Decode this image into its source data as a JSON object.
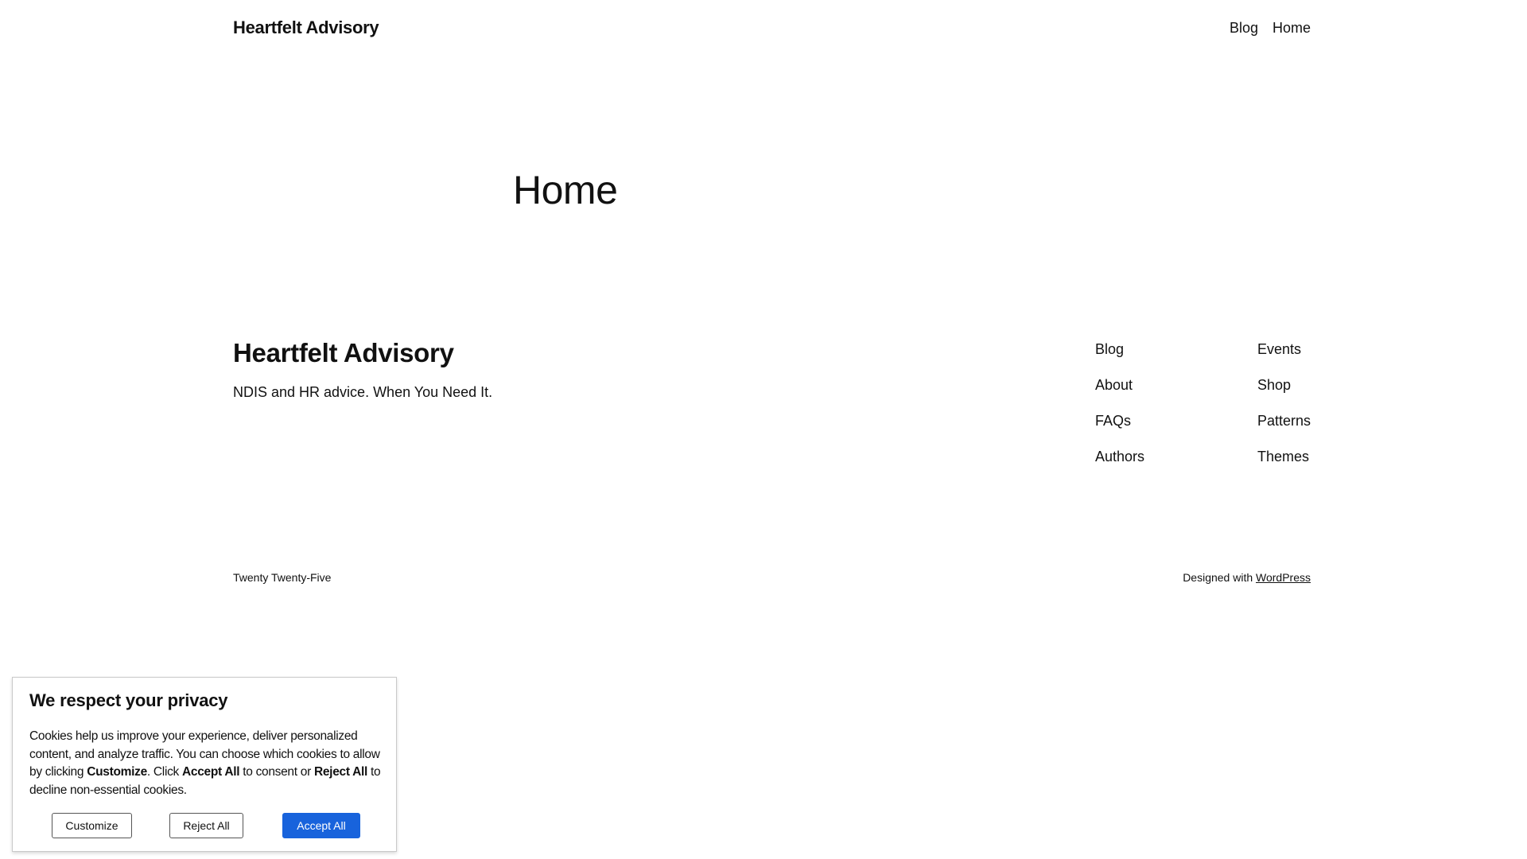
{
  "header": {
    "site_title": "Heartfelt Advisory",
    "nav": [
      "Blog",
      "Home"
    ]
  },
  "main": {
    "page_title": "Home"
  },
  "footer": {
    "site_title": "Heartfelt Advisory",
    "tagline": "NDIS and HR advice. When You Need It.",
    "nav_col1": [
      "Blog",
      "About",
      "FAQs",
      "Authors"
    ],
    "nav_col2": [
      "Events",
      "Shop",
      "Patterns",
      "Themes"
    ],
    "theme_name": "Twenty Twenty-Five",
    "designed_with": "Designed with",
    "wordpress_link": "WordPress"
  },
  "cookie_banner": {
    "title": "We respect your privacy",
    "text_part1": "Cookies help us improve your experience, deliver personalized content, and analyze traffic. You can choose which cookies to allow by clicking ",
    "text_customize": "Customize",
    "text_part2": ". Click ",
    "text_accept": "Accept All",
    "text_part3": " to consent or ",
    "text_reject": "Reject All",
    "text_part4": " to decline non-essential cookies.",
    "btn_customize": "Customize",
    "btn_reject": "Reject All",
    "btn_accept": "Accept All",
    "accent_color": "#1863dc"
  }
}
